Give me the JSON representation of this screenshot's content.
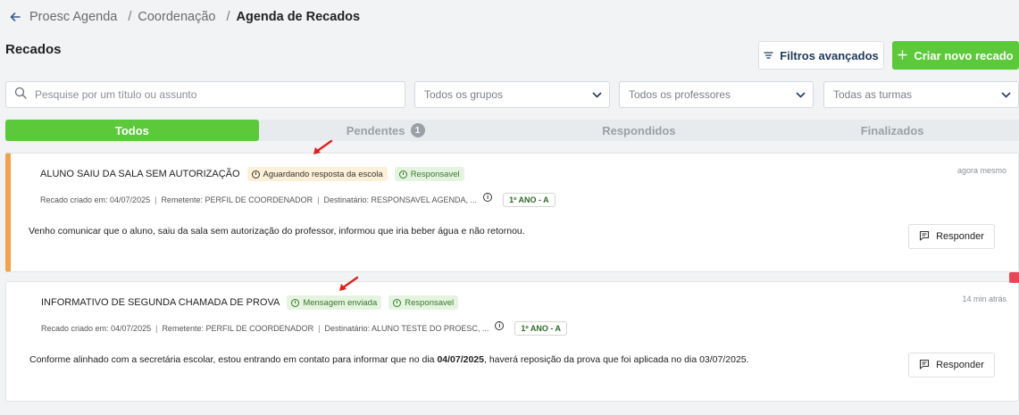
{
  "breadcrumb": {
    "items": [
      "Proesc Agenda",
      "Coordenação"
    ],
    "current": "Agenda de Recados",
    "separator": "/"
  },
  "page": {
    "title": "Recados",
    "filters_label": "Filtros avançados",
    "new_label": "Criar novo recado"
  },
  "filters": {
    "search_placeholder": "Pesquise por um título ou assunto",
    "groups": "Todos os grupos",
    "teachers": "Todos os professores",
    "classes": "Todas as turmas"
  },
  "tabs": [
    {
      "label": "Todos",
      "active": true
    },
    {
      "label": "Pendentes",
      "count": "1"
    },
    {
      "label": "Respondidos"
    },
    {
      "label": "Finalizados"
    }
  ],
  "messages": [
    {
      "title": "ALUNO SAIU DA SALA SEM AUTORIZAÇÃO",
      "status": "Aguardando resposta da escola",
      "tag": "Responsavel",
      "time": "agora mesmo",
      "created": "Recado criado em: 04/07/2025",
      "sender": "Remetente: PERFIL DE COORDENADOR",
      "recipient": "Destinatário: RESPONSAVEL AGENDA, ...",
      "grade": "1º ANO - A",
      "body": "Venho comunicar que o aluno, saiu da sala sem autorização do professor, informou que iria beber água e não retornou.",
      "reply_label": "Responder",
      "accent_color": "#f5a04a"
    },
    {
      "title": "INFORMATIVO DE SEGUNDA CHAMADA DE PROVA",
      "status": "Mensagem enviada",
      "tag": "Responsavel",
      "time": "14 min atrás",
      "created": "Recado criado em: 04/07/2025",
      "sender": "Remetente: PERFIL DE COORDENADOR",
      "recipient": "Destinatário: ALUNO TESTE DO PROESC, ...",
      "grade": "1º ANO - A",
      "body_pre": "Conforme alinhado com a secretária escolar, estou entrando em contato para informar que no dia ",
      "body_bold": "04/07/2025",
      "body_post": ", haverá reposição da prova que foi aplicada no dia 03/07/2025.",
      "reply_label": "Responder"
    }
  ],
  "colors": {
    "primary_green": "#5cc93a",
    "annotation_red": "#e02020"
  }
}
